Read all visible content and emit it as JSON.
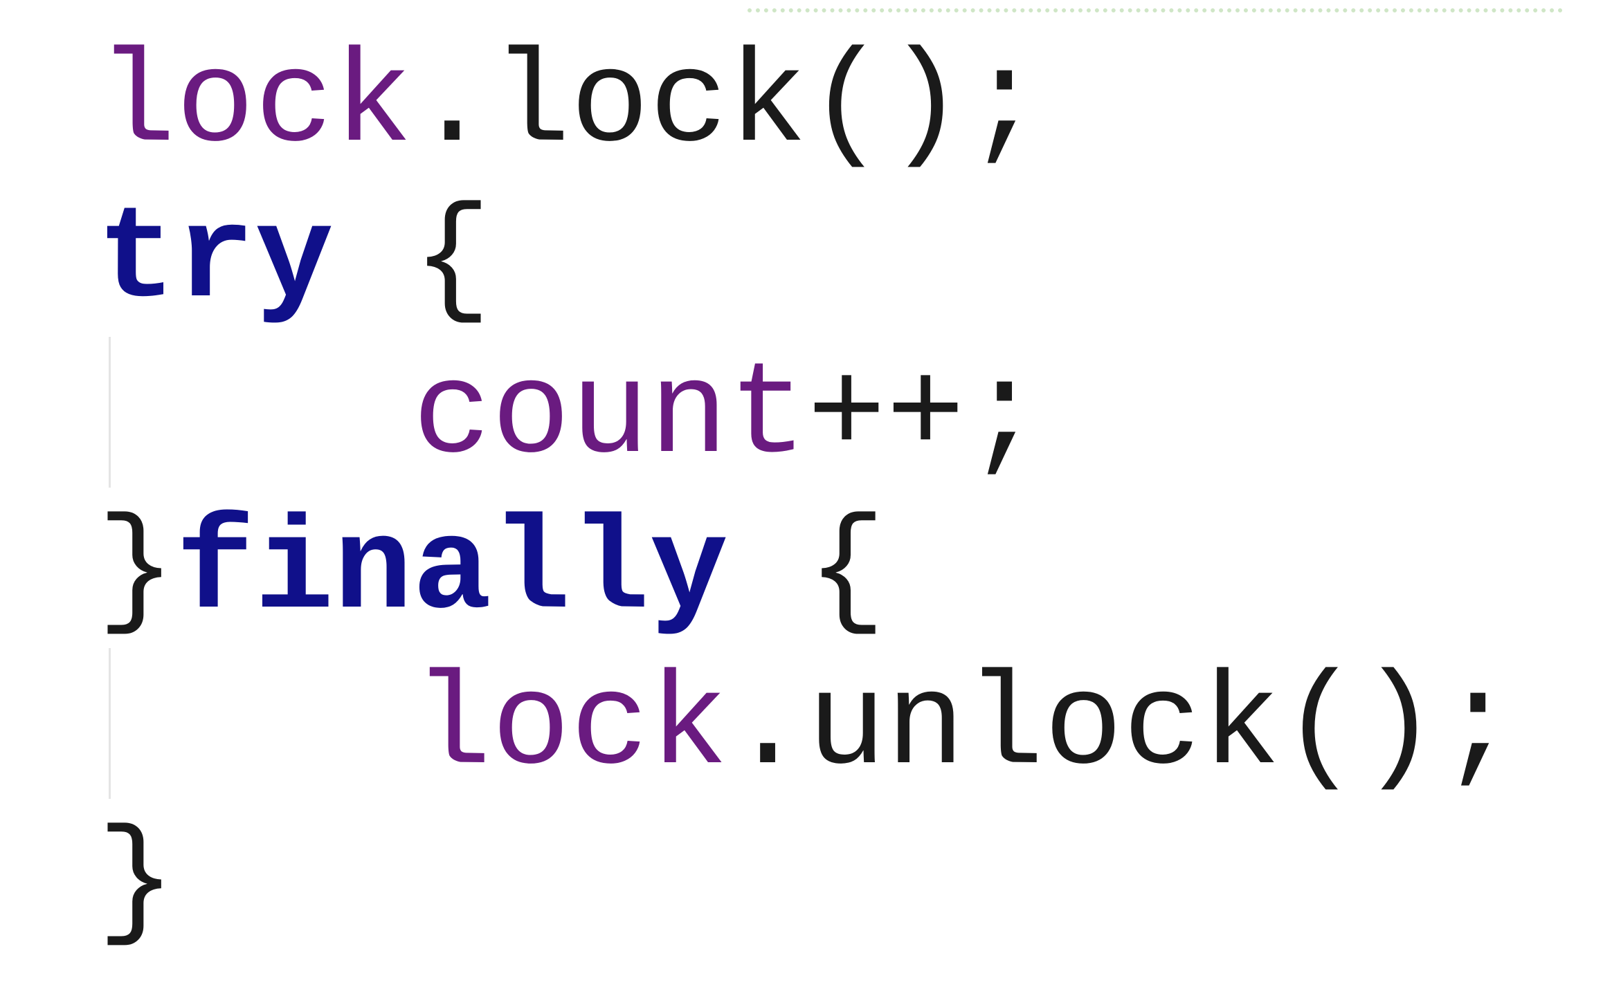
{
  "editor": {
    "colors": {
      "variable": "#6a1b80",
      "keyword": "#10108a",
      "default": "#000000"
    },
    "lines": [
      {
        "parts": [
          {
            "text": "lock",
            "kind": "variable"
          },
          {
            "text": ".lock();",
            "kind": "default"
          }
        ]
      },
      {
        "parts": [
          {
            "text": "try",
            "kind": "keyword"
          },
          {
            "text": " {",
            "kind": "default"
          }
        ]
      },
      {
        "parts": [
          {
            "text": "    ",
            "kind": "default"
          },
          {
            "text": "count",
            "kind": "variable"
          },
          {
            "text": "++;",
            "kind": "default"
          }
        ]
      },
      {
        "parts": [
          {
            "text": "}",
            "kind": "default"
          },
          {
            "text": "finally",
            "kind": "keyword"
          },
          {
            "text": " {",
            "kind": "default"
          }
        ]
      },
      {
        "parts": [
          {
            "text": "    ",
            "kind": "default"
          },
          {
            "text": "lock",
            "kind": "variable"
          },
          {
            "text": ".unlock();",
            "kind": "default"
          }
        ]
      },
      {
        "parts": [
          {
            "text": "}",
            "kind": "default"
          }
        ]
      }
    ]
  }
}
